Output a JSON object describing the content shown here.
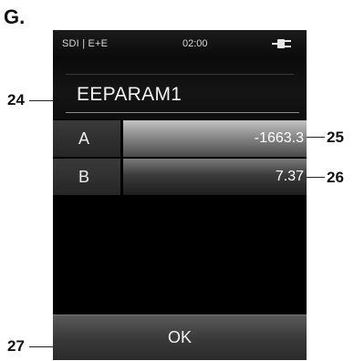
{
  "figure": {
    "label": "G."
  },
  "callouts": {
    "c24": "24",
    "c25": "25",
    "c26": "26",
    "c27": "27"
  },
  "statusbar": {
    "source": "SDI | E+E",
    "time": "02:00",
    "power_icon": "plug-icon"
  },
  "parameter": {
    "name": "EEPARAM1"
  },
  "rows": [
    {
      "key": "A",
      "value": "-1663.3"
    },
    {
      "key": "B",
      "value": "7.37"
    }
  ],
  "ok_button": {
    "label": "OK"
  }
}
